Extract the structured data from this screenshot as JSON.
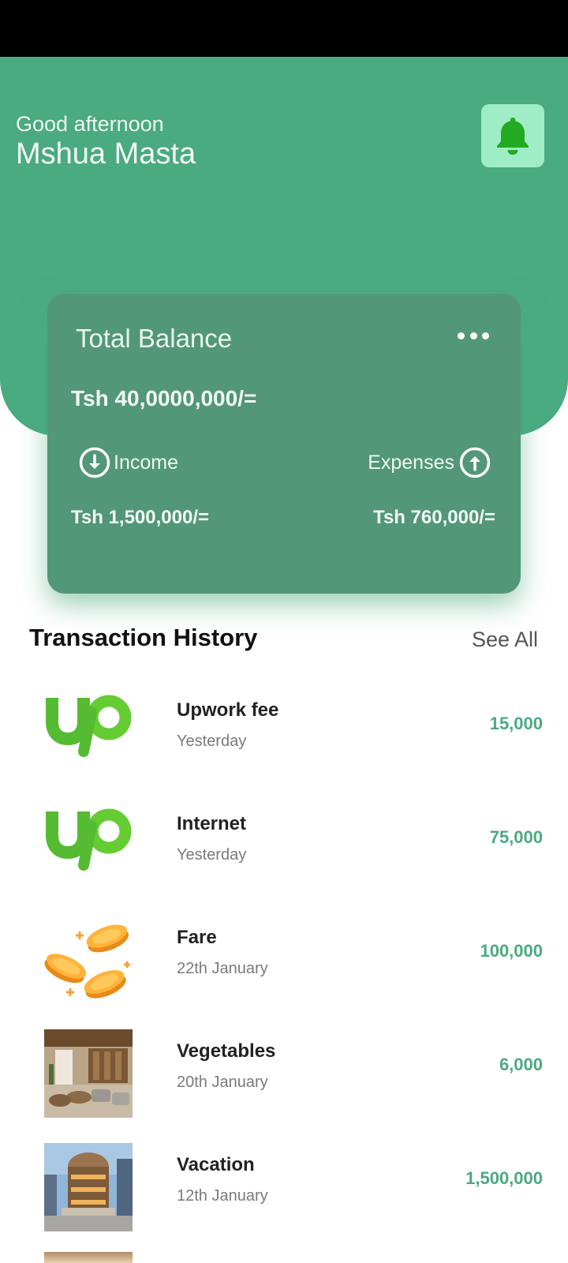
{
  "header": {
    "greeting": "Good afternoon",
    "user_name": "Mshua Masta",
    "notification_icon": "bell-icon"
  },
  "balance_card": {
    "title": "Total Balance",
    "menu_icon": "more-horizontal-icon",
    "total_balance": "Tsh 40,0000,000/=",
    "income_label": "Income",
    "income_amount": "Tsh 1,500,000/=",
    "expenses_label": "Expenses",
    "expenses_amount": "Tsh 760,000/="
  },
  "transactions": {
    "title": "Transaction History",
    "see_all": "See All",
    "items": [
      {
        "name": "Upwork fee",
        "date": "Yesterday",
        "amount": "15,000",
        "icon": "upwork-logo"
      },
      {
        "name": "Internet",
        "date": "Yesterday",
        "amount": "75,000",
        "icon": "upwork-logo"
      },
      {
        "name": "Fare",
        "date": "22th January",
        "amount": "100,000",
        "icon": "coins-icon"
      },
      {
        "name": "Vegetables",
        "date": "20th January",
        "amount": "6,000",
        "icon": "interior-photo"
      },
      {
        "name": "Vacation",
        "date": "12th January",
        "amount": "1,500,000",
        "icon": "building-photo"
      }
    ]
  },
  "colors": {
    "accent": "#4aaa80",
    "card": "#529778",
    "bell_bg": "#9fedc6",
    "bell": "#22aa22"
  }
}
